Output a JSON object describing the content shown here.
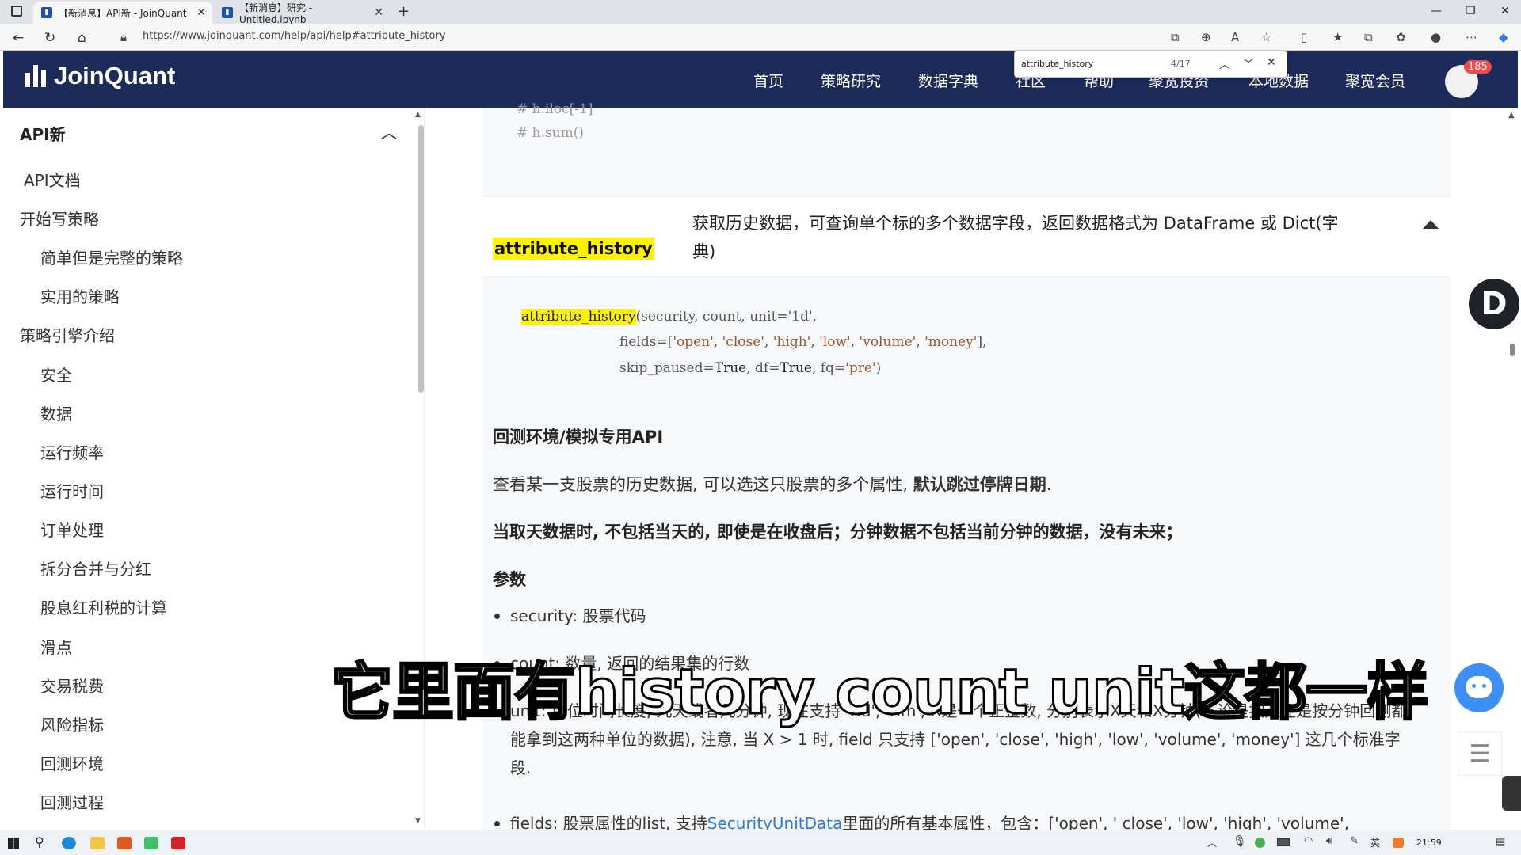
{
  "browser": {
    "tabs": [
      {
        "label": "【新消息】API新 - JoinQuant"
      },
      {
        "label": "【新消息】研究 - Untitled.ipynb"
      }
    ],
    "url": "https://www.joinquant.com/help/api/help#attribute_history",
    "find": {
      "query": "attribute_history",
      "count": "4/17"
    }
  },
  "site": {
    "logo": "JoinQuant",
    "nav": [
      "首页",
      "策略研究",
      "数据字典",
      "社区",
      "帮助",
      "聚宽投资",
      "本地数据",
      "聚宽会员"
    ],
    "badge": "185"
  },
  "sidebar": {
    "title": "API新",
    "items": [
      {
        "label": "API文档"
      },
      {
        "label": "开始写策略"
      },
      {
        "label": "简单但是完整的策略"
      },
      {
        "label": "实用的策略"
      },
      {
        "label": "策略引擎介绍"
      },
      {
        "label": "安全"
      },
      {
        "label": "数据"
      },
      {
        "label": "运行频率"
      },
      {
        "label": "运行时间"
      },
      {
        "label": "订单处理"
      },
      {
        "label": "拆分合并与分红"
      },
      {
        "label": "股息红利税的计算"
      },
      {
        "label": "滑点"
      },
      {
        "label": "交易税费"
      },
      {
        "label": "风险指标"
      },
      {
        "label": "回测环境"
      },
      {
        "label": "回测过程"
      }
    ]
  },
  "main": {
    "prev_code": [
      "# h.iloc[-1]",
      "# h.sum()"
    ],
    "func_name": "attribute_history",
    "func_desc": "获取历史数据，可查询单个标的多个数据字段，返回数据格式为 DataFrame 或 Dict(字典)",
    "signature": {
      "line1_rest": "(security, count, unit='1d',",
      "line2_prefix": "fields=[",
      "fields": [
        "'open'",
        "'close'",
        "'high'",
        "'low'",
        "'volume'",
        "'money'"
      ],
      "line3_a": "skip_paused=",
      "line3_b": "True",
      "line3_c": ", df=",
      "line3_d": "True",
      "line3_e": ", fq=",
      "line3_f": "'pre'",
      "line3_g": ")"
    },
    "section_title": "回测环境/模拟专用API",
    "para1_a": "查看某一支股票的历史数据, 可以选这只股票的多个属性, ",
    "para1_b": "默认跳过停牌日期",
    "para1_c": ".",
    "para2": "当取天数据时, 不包括当天的, 即使是在收盘后；分钟数据不包括当前分钟的数据，没有未来；",
    "params_title": "参数",
    "bullets": [
      "security: 股票代码",
      "count: 数量, 返回的结果集的行数",
      "unit: 单位时间长度, 几天或者几分钟, 现在支持 'Xd', 'Xm', X是一个正整数, 分别表示X天和X分钟(不论是按天还是按分钟回测都能拿到这两种单位的数据), 注意, 当 X > 1 时, field 只支持 ['open', 'close', 'high', 'low', 'volume', 'money'] 这几个标准字段.",
      "fields: 股票属性的list, 支持"
    ],
    "bullet4_link": "SecurityUnitData",
    "bullet4_rest": "里面的所有基本属性，包含：['open', ' close', 'low', 'high', 'volume',"
  },
  "subtitle": "它里面有history count unit这都一样",
  "taskbar": {
    "time": "21:59"
  }
}
